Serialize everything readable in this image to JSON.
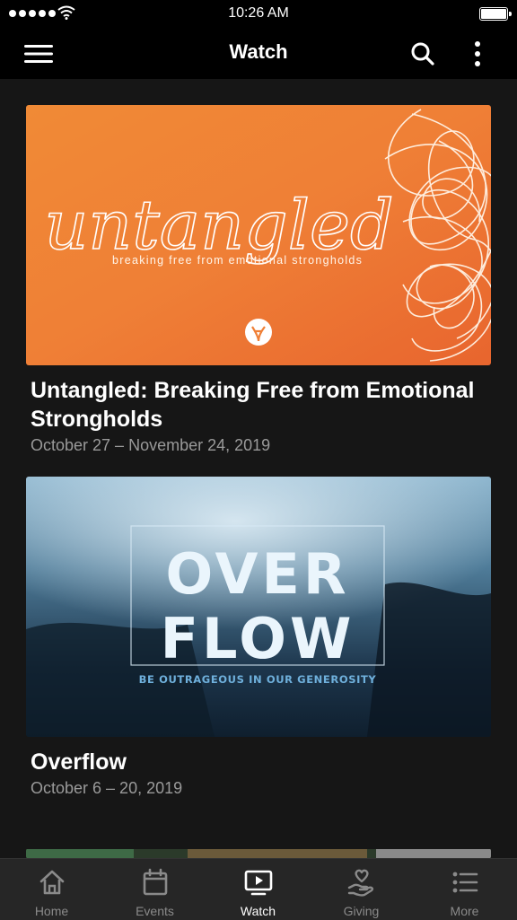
{
  "status_bar": {
    "time": "10:26 AM"
  },
  "header": {
    "title": "Watch"
  },
  "series": [
    {
      "title": "Untangled: Breaking Free from Emotional Strongholds",
      "dates": "October 27 – November 24, 2019",
      "art_title": "untangled",
      "art_subtitle": "breaking free from emotional strongholds"
    },
    {
      "title": "Overflow",
      "dates": "October 6 – 20, 2019",
      "art_line1": "OVER",
      "art_line2": "FLOW",
      "art_tagline": "BE OUTRAGEOUS IN OUR GENEROSITY"
    }
  ],
  "tabs": [
    {
      "label": "Home",
      "icon": "home-icon"
    },
    {
      "label": "Events",
      "icon": "calendar-icon"
    },
    {
      "label": "Watch",
      "icon": "tv-play-icon",
      "active": true
    },
    {
      "label": "Giving",
      "icon": "heart-hand-icon"
    },
    {
      "label": "More",
      "icon": "list-icon"
    }
  ],
  "colors": {
    "background": "#161616",
    "bar": "#000000",
    "tabbar": "#262626",
    "inactive": "#8a8a8a"
  }
}
